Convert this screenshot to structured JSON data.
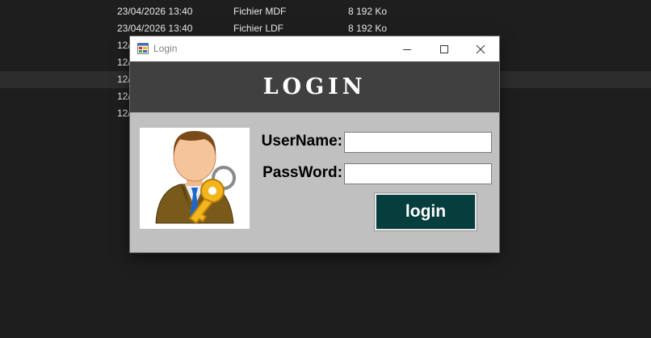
{
  "background_files": [
    {
      "date": "23/04/2026 13:40",
      "type": "Fichier MDF",
      "size": "8 192 Ko"
    },
    {
      "date": "23/04/2026 13:40",
      "type": "Fichier LDF",
      "size": "8 192 Ko"
    },
    {
      "date": "12/",
      "type": "",
      "size": ""
    },
    {
      "date": "12/",
      "type": "",
      "size": ""
    },
    {
      "date": "12/",
      "type": "",
      "size": ""
    },
    {
      "date": "12/",
      "type": "",
      "size": ""
    },
    {
      "date": "12/",
      "type": "",
      "size": ""
    }
  ],
  "window": {
    "title": "Login",
    "icon": "app-window-icon",
    "controls": [
      "minimize-icon",
      "maximize-icon",
      "close-icon"
    ]
  },
  "header": {
    "heading": "LOGIN"
  },
  "form": {
    "username_label": "UserName:",
    "password_label": "PassWord:",
    "username_value": "",
    "password_value": "",
    "login_button": "login",
    "avatar_icon": "user-with-key-icon"
  },
  "colors": {
    "header_bg": "#404040",
    "form_bg": "#c0c0c0",
    "button_bg": "#063d3d",
    "desktop_bg": "#1e1e1e"
  }
}
